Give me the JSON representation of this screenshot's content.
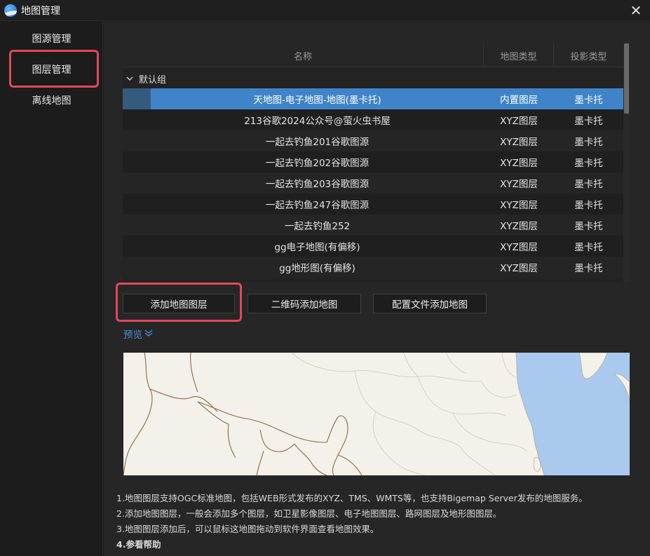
{
  "window": {
    "title": "地图管理",
    "close_glyph": "✕",
    "logo_icon": "app-globe-icon"
  },
  "sidebar": {
    "items": [
      {
        "label": "图源管理"
      },
      {
        "label": "图层管理"
      },
      {
        "label": "离线地图"
      }
    ],
    "active_index": 1
  },
  "table": {
    "columns": [
      "名称",
      "地图类型",
      "投影类型"
    ],
    "group": {
      "label": "默认组",
      "expanded": true
    },
    "rows": [
      {
        "name": "天地图-电子地图-地图(墨卡托)",
        "map_type": "内置图层",
        "projection": "墨卡托",
        "selected": true
      },
      {
        "name": "213谷歌2024公众号@萤火虫书屋",
        "map_type": "XYZ图层",
        "projection": "墨卡托"
      },
      {
        "name": "一起去钓鱼201谷歌图源",
        "map_type": "XYZ图层",
        "projection": "墨卡托"
      },
      {
        "name": "一起去钓鱼202谷歌图源",
        "map_type": "XYZ图层",
        "projection": "墨卡托"
      },
      {
        "name": "一起去钓鱼203谷歌图源",
        "map_type": "XYZ图层",
        "projection": "墨卡托"
      },
      {
        "name": "一起去钓鱼247谷歌图源",
        "map_type": "XYZ图层",
        "projection": "墨卡托"
      },
      {
        "name": "一起去钓鱼252",
        "map_type": "XYZ图层",
        "projection": "墨卡托"
      },
      {
        "name": "gg电子地图(有偏移)",
        "map_type": "XYZ图层",
        "projection": "墨卡托"
      },
      {
        "name": "gg地形图(有偏移)",
        "map_type": "XYZ图层",
        "projection": "墨卡托"
      }
    ]
  },
  "buttons": {
    "add_layer": "添加地图图层",
    "qr_add": "二维码添加地图",
    "config_add": "配置文件添加地图"
  },
  "preview": {
    "label": "预览"
  },
  "notes": [
    "1.地图图层支持OGC标准地图，包括WEB形式发布的XYZ、TMS、WMTS等，也支持Bigemap Server发布的地图服务。",
    "2.添加地图图层，一般会添加多个图层，如卫星影像图层、电子地图图层、路网图层及地形图图层。",
    "3.地图图层添加后，可以鼠标这地图拖动到软件界面查看地图效果。",
    "4.参看帮助"
  ],
  "colors": {
    "selected_row": "#3f84c8",
    "highlight_box": "#e2485a",
    "link": "#4a90d9",
    "map_land": "#f3f1ea",
    "map_sea": "#a9c9ee",
    "map_border": "#8a6a4a"
  }
}
